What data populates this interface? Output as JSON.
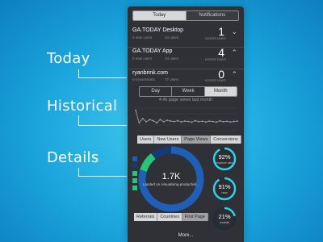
{
  "callouts": {
    "today": "Today",
    "historical": "Historical",
    "details": "Details"
  },
  "top_tabs": [
    "Today",
    "Notifications"
  ],
  "rows": [
    {
      "title": "GA.TODAY Desktop",
      "stat1": "0 new users",
      "stat2": "34 users",
      "value": "1",
      "value_label": "current users",
      "expanded": false
    },
    {
      "title": "GA.TODAY App",
      "stat1": "0 new users",
      "stat2": "34 users",
      "value": "4",
      "value_label": "current users",
      "expanded": false
    },
    {
      "title": "ryanbrink.com",
      "stat1": "0 conversions",
      "stat2": "77 users",
      "value": "0",
      "value_label": "current users",
      "expanded": true
    }
  ],
  "period_tabs": [
    "Day",
    "Week",
    "Month"
  ],
  "period_selected": "Month",
  "chart_caption": "4.4k page views last month",
  "metric_tabs": [
    "Users",
    "New Users",
    "Page Views",
    "Conversions"
  ],
  "metric_selected": "Page Views",
  "donut": {
    "value": "1.7K",
    "label": "Landed on /visualising-productivit..."
  },
  "percent_circles": [
    {
      "value": "92%",
      "label": "bounce rate",
      "fill": 0.92,
      "color": "#2fd0ea"
    },
    {
      "value": "91%",
      "label": "new",
      "fill": 0.91,
      "color": "#2fd0ea"
    },
    {
      "value": "21%",
      "label": "mobile",
      "fill": 0.21,
      "color": "#2fd0ea"
    }
  ],
  "detail_tabs": [
    "Referrals",
    "Countries",
    "First Page"
  ],
  "detail_selected": "First Page",
  "footer": "More...",
  "colors": {
    "accent": "#2fd0ea",
    "donut_blue": "#1f5fb8",
    "donut_green": "#28c478",
    "donut_dark": "#163b73"
  }
}
